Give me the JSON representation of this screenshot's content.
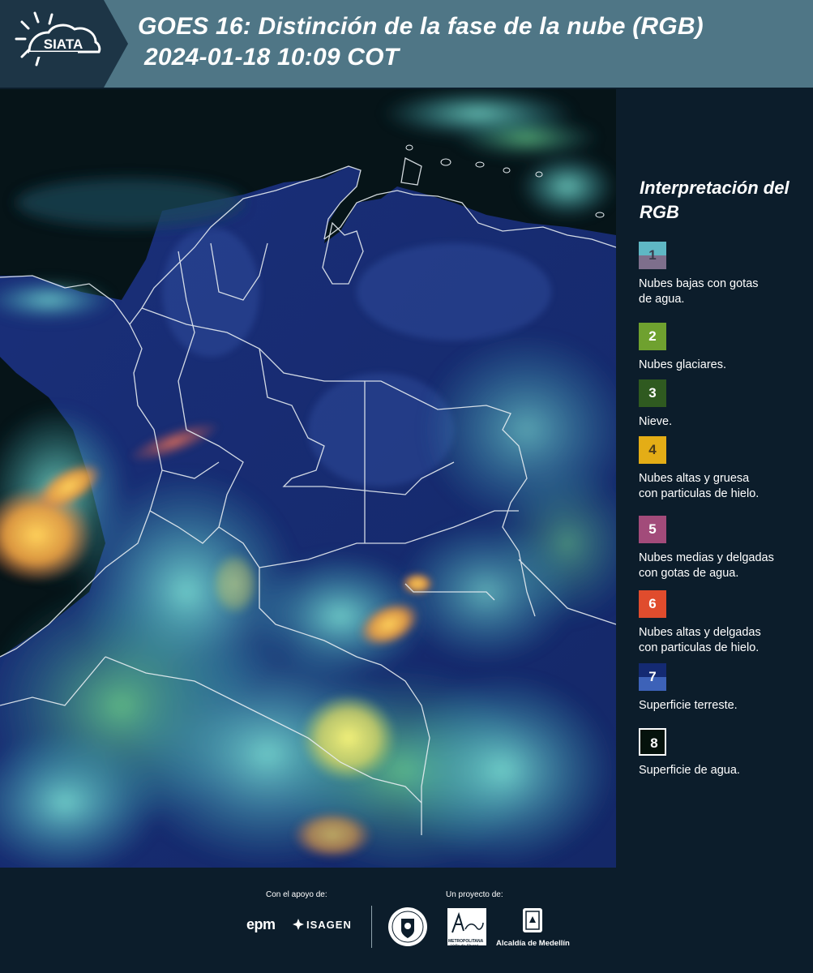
{
  "header": {
    "logo_text": "SIATA",
    "title_line1": "GOES 16: Distinción de la fase de la nube (RGB)",
    "title_line2": "2024-01-18 10:09 COT"
  },
  "legend": {
    "title": "Interpretación del RGB",
    "items": [
      {
        "number": "1",
        "label_lines": [
          "Nubes bajas con gotas",
          "de agua."
        ],
        "colors": [
          "#5fb7c4",
          "#7e6f8c"
        ],
        "num_color": "#3a3a4a"
      },
      {
        "number": "2",
        "label_lines": [
          "Nubes glaciares."
        ],
        "colors": [
          "#6fa12f"
        ],
        "num_color": "#ffffff"
      },
      {
        "number": "3",
        "label_lines": [
          "Nieve."
        ],
        "colors": [
          "#2f5a20"
        ],
        "num_color": "#ffffff"
      },
      {
        "number": "4",
        "label_lines": [
          "Nubes altas y gruesa",
          "con particulas de hielo."
        ],
        "colors": [
          "#e4ad16"
        ],
        "num_color": "#4a3a1a"
      },
      {
        "number": "5",
        "label_lines": [
          "Nubes medias y delgadas",
          "con gotas de agua."
        ],
        "colors": [
          "#a24b7a"
        ],
        "num_color": "#ffffff"
      },
      {
        "number": "6",
        "label_lines": [
          "Nubes altas y delgadas",
          "con particulas de hielo."
        ],
        "colors": [
          "#e04c2d"
        ],
        "num_color": "#ffffff"
      },
      {
        "number": "7",
        "label_lines": [
          "Superficie terreste."
        ],
        "colors": [
          "#142a72",
          "#3d62b8"
        ],
        "num_color": "#ffffff"
      },
      {
        "number": "8",
        "label_lines": [
          "Superficie de agua."
        ],
        "colors": [
          "#05120c"
        ],
        "num_color": "#ffffff",
        "border": "#ffffff"
      }
    ]
  },
  "footer": {
    "support_label": "Con el apoyo de:",
    "project_label": "Un proyecto de:",
    "partners": [
      "epm",
      "ISAGEN"
    ],
    "project_partners": [
      "METROPOLITANA",
      "Valle de Aburrá",
      "Alcaldía de Medellín"
    ]
  }
}
